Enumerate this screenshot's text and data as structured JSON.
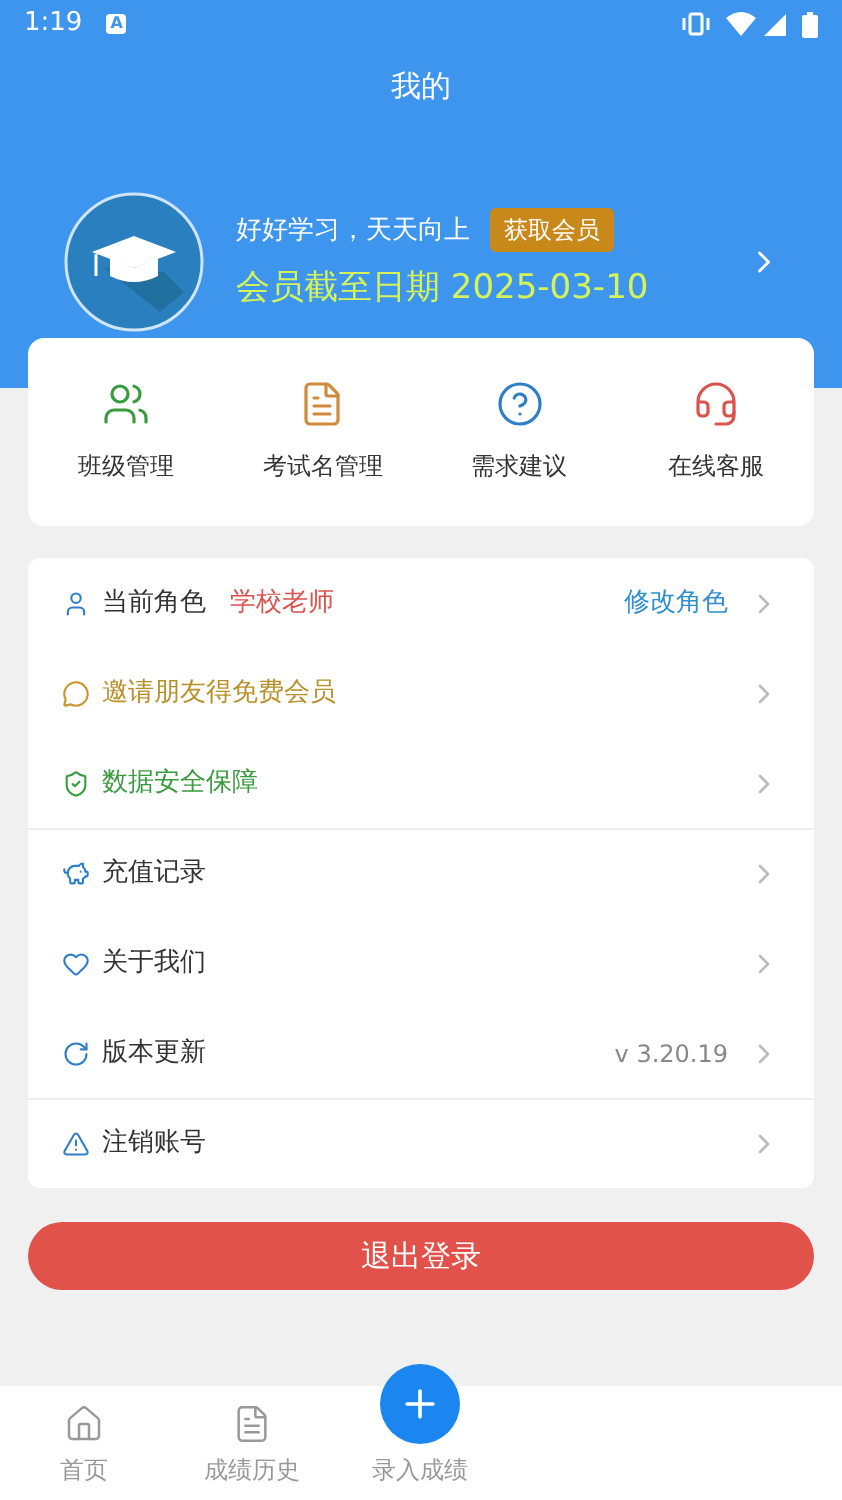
{
  "status_bar": {
    "time": "1:19",
    "badge": "A"
  },
  "header": {
    "title": "我的"
  },
  "profile": {
    "motto": "好好学习，天天向上",
    "vip_button": "获取会员",
    "expiry": "会员截至日期 2025-03-10"
  },
  "shortcuts": [
    {
      "label": "班级管理"
    },
    {
      "label": "考试名管理"
    },
    {
      "label": "需求建议"
    },
    {
      "label": "在线客服"
    }
  ],
  "menu": [
    {
      "label": "当前角色",
      "color": "#333333",
      "tag": "学校老师",
      "action": "修改角色"
    },
    {
      "label": "邀请朋友得免费会员",
      "color": "#b8902a"
    },
    {
      "label": "数据安全保障",
      "color": "#3a9a3e"
    },
    {
      "label": "充值记录",
      "color": "#333333"
    },
    {
      "label": "关于我们",
      "color": "#333333"
    },
    {
      "label": "版本更新",
      "color": "#333333",
      "value": "v 3.20.19"
    },
    {
      "label": "注销账号",
      "color": "#333333"
    }
  ],
  "logout_button": "退出登录",
  "bottom_nav": [
    {
      "label": "首页",
      "selected": false
    },
    {
      "label": "成绩历史",
      "selected": false
    },
    {
      "label": "录入成绩",
      "selected": false
    }
  ]
}
